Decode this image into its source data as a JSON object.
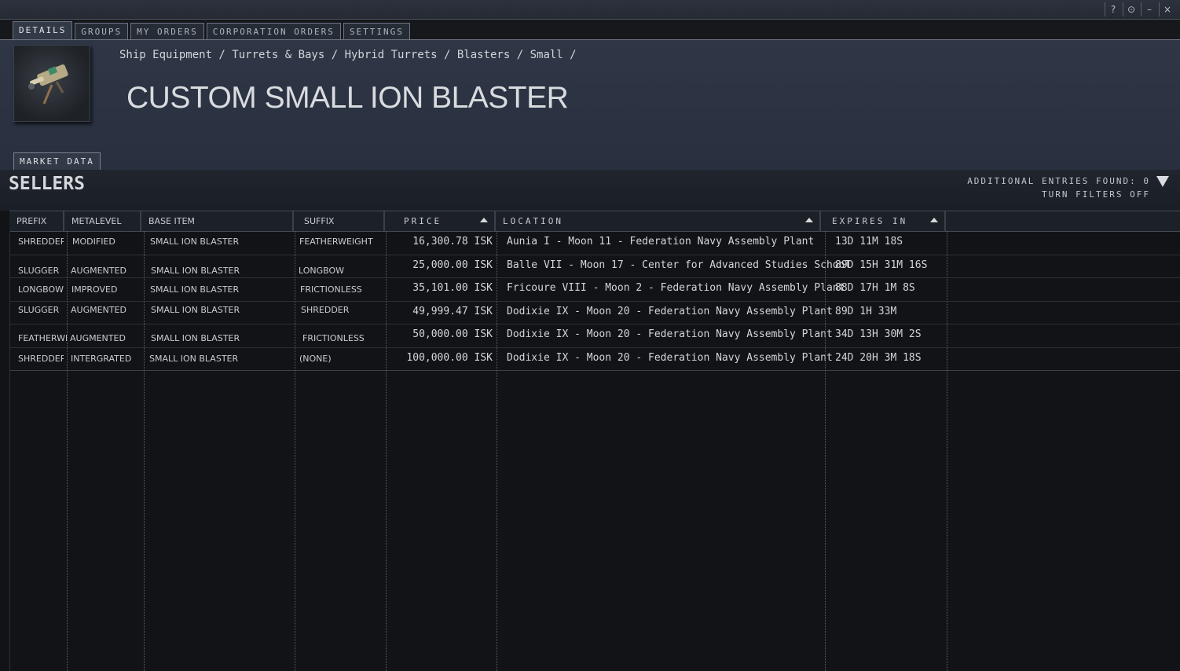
{
  "window_controls": [
    "?",
    "⊙",
    "–",
    "×"
  ],
  "tabs": [
    {
      "label": "DETAILS",
      "active": true
    },
    {
      "label": "GROUPS",
      "active": false
    },
    {
      "label": "MY ORDERS",
      "active": false
    },
    {
      "label": "CORPORATION ORDERS",
      "active": false
    },
    {
      "label": "SETTINGS",
      "active": false
    }
  ],
  "breadcrumb": "Ship Equipment / Turrets & Bays / Hybrid Turrets / Blasters / Small /",
  "item_title": "CUSTOM SMALL ION BLASTER",
  "subtab_label": "MARKET DATA",
  "sellers_title": "SELLERS",
  "additional_entries": "ADDITIONAL ENTRIES FOUND: 0",
  "turn_filters_off": "TURN FILTERS OFF",
  "columns": {
    "prefix": "PREFIX",
    "metalevel": "METALEVEL",
    "base_item": "BASE ITEM",
    "suffix": "SUFFIX",
    "price": "PRICE",
    "location": "LOCATION",
    "expires": "EXPIRES IN"
  },
  "rows": [
    {
      "prefix": "SHREDDER",
      "metalevel": "MODIFIED",
      "base": "SMALL ION BLASTER",
      "suffix": "FEATHERWEIGHT",
      "price": "16,300.78 ISK",
      "location": "Aunia I - Moon 11 - Federation Navy Assembly Plant",
      "expires": "13D 11M 18S"
    },
    {
      "prefix": "SLUGGER",
      "metalevel": "AUGMENTED",
      "base": "SMALL ION BLASTER",
      "suffix": "LONGBOW",
      "price": "25,000.00 ISK",
      "location": "Balle VII - Moon 17 - Center for Advanced Studies School",
      "expires": "89D 15H 31M 16S"
    },
    {
      "prefix": "LONGBOW",
      "metalevel": "IMPROVED",
      "base": "SMALL ION BLASTER",
      "suffix": "FRICTIONLESS",
      "price": "35,101.00 ISK",
      "location": "Fricoure VIII - Moon 2 - Federation Navy Assembly Plant",
      "expires": "88D 17H 1M 8S"
    },
    {
      "prefix": "SLUGGER",
      "metalevel": "AUGMENTED",
      "base": "SMALL ION BLASTER",
      "suffix": "SHREDDER",
      "price": "49,999.47 ISK",
      "location": "Dodixie IX - Moon 20 - Federation Navy Assembly Plant",
      "expires": "89D 1H 33M"
    },
    {
      "prefix": "FEATHERWE",
      "metalevel": "AUGMENTED",
      "base": "SMALL ION BLASTER",
      "suffix": "FRICTIONLESS",
      "price": "50,000.00 ISK",
      "location": "Dodixie IX - Moon 20 - Federation Navy Assembly Plant",
      "expires": "34D 13H 30M 2S"
    },
    {
      "prefix": "SHREDDER",
      "metalevel": "INTERGRATED",
      "base": "SMALL ION BLASTER",
      "suffix": "(NONE)",
      "price": "100,000.00 ISK",
      "location": "Dodixie IX - Moon 20 - Federation Navy Assembly Plant",
      "expires": "24D 20H 3M 18S"
    }
  ]
}
